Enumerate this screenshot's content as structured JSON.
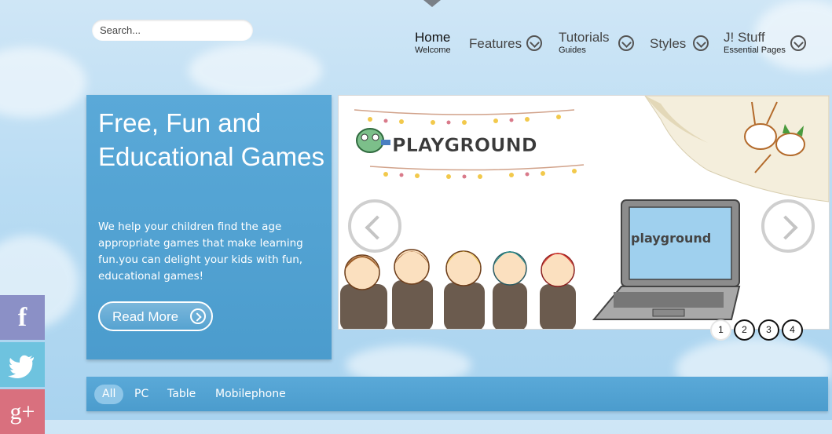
{
  "search": {
    "placeholder": "Search..."
  },
  "nav": {
    "items": [
      {
        "label": "Home",
        "sub": "Welcome",
        "has_dropdown": false,
        "active": true
      },
      {
        "label": "Features",
        "sub": "",
        "has_dropdown": true,
        "active": false
      },
      {
        "label": "Tutorials",
        "sub": "Guides",
        "has_dropdown": true,
        "active": false
      },
      {
        "label": "Styles",
        "sub": "",
        "has_dropdown": true,
        "active": false
      },
      {
        "label": "J! Stuff",
        "sub": "Essential Pages",
        "has_dropdown": true,
        "active": false
      }
    ]
  },
  "hero": {
    "title": "Free, Fun and Educational Games",
    "text": "We help your children find the age appropriate games that make learning fun.you can delight your kids with fun, educational games!",
    "read_more_label": "Read More"
  },
  "slider": {
    "banner_text": "PLAYGROUND",
    "laptop_text": "playground",
    "pages": [
      "1",
      "2",
      "3",
      "4"
    ],
    "active_page": "1"
  },
  "filters": {
    "items": [
      "All",
      "PC",
      "Table",
      "Mobilephone"
    ],
    "active": "All"
  },
  "social": {
    "items": [
      {
        "name": "facebook",
        "glyph": "f",
        "color": "#8b90c6"
      },
      {
        "name": "twitter",
        "glyph": "",
        "color": "#6ec3df"
      },
      {
        "name": "google-plus",
        "glyph": "g+",
        "color": "#d9707e"
      }
    ]
  },
  "colors": {
    "panel_blue": "#4fa1d1",
    "sky": "#b9dcf3"
  }
}
